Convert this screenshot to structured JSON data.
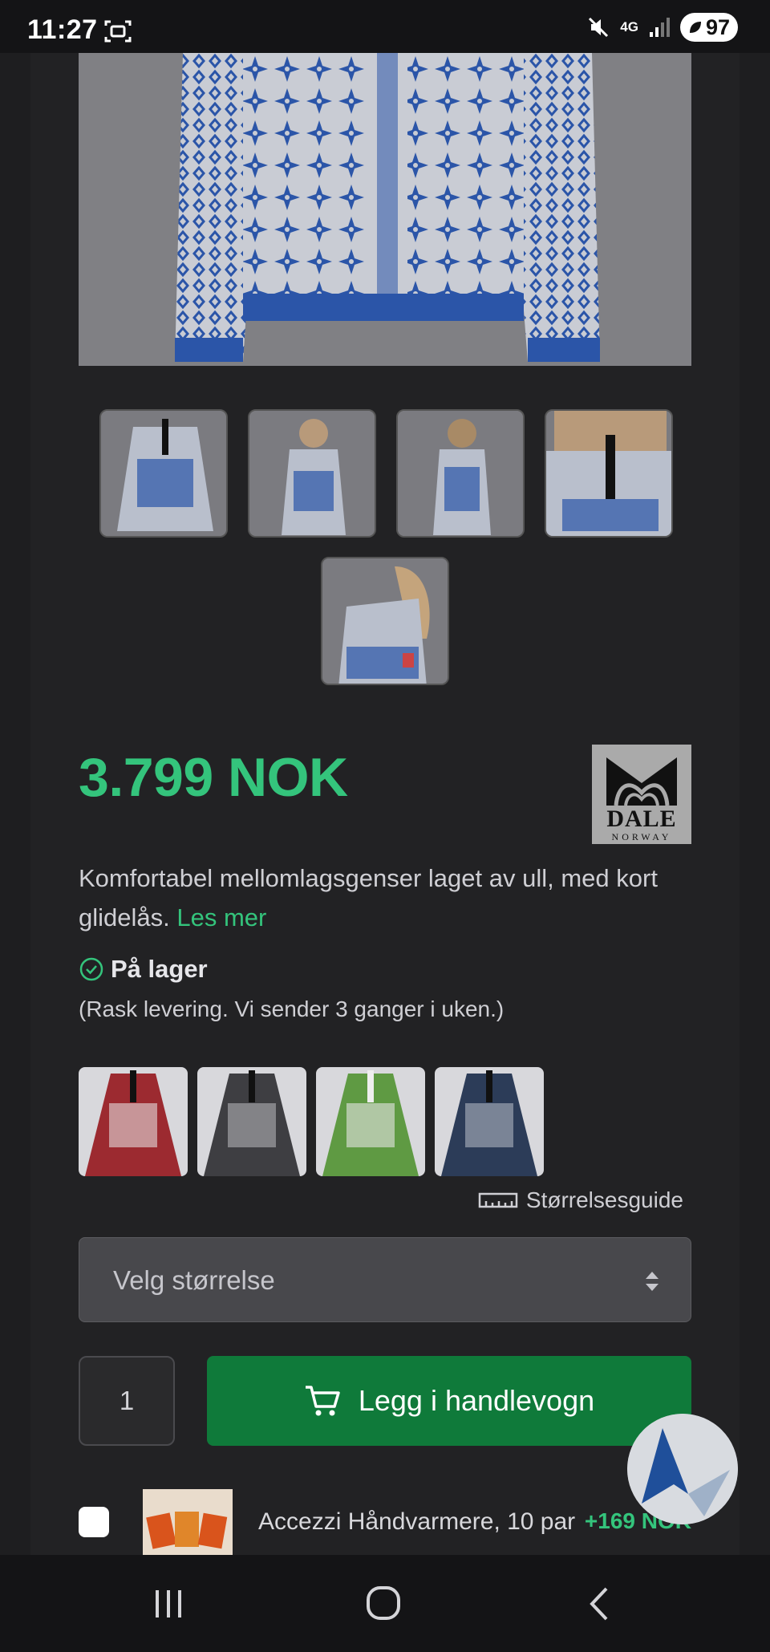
{
  "status_bar": {
    "time": "11:27",
    "network": "4G",
    "battery": "97"
  },
  "product": {
    "price": "3.799 NOK",
    "brand": {
      "name": "DALE",
      "sub": "NORWAY"
    },
    "description": "Komfortabel mellomlagsgenser laget av ull, med kort glidelås.",
    "read_more": "Les mer",
    "stock_status": "På lager",
    "stock_note": "(Rask levering. Vi sender 3 ganger i uken.)",
    "size_guide": "Størrelsesguide",
    "size_select_placeholder": "Velg størrelse",
    "quantity": "1",
    "add_to_cart": "Legg i handlevogn",
    "variants": [
      {
        "color": "#9c2a30"
      },
      {
        "color": "#3e3e42"
      },
      {
        "color": "#5f9a43"
      },
      {
        "color": "#2c3c58"
      }
    ]
  },
  "addon": {
    "label": "Accezzi Håndvarmere, 10 par",
    "price": "+169 NOK"
  },
  "colors": {
    "accent": "#34c47c",
    "cart_button": "#0f7a3a",
    "pattern_blue": "#2b55a8"
  }
}
